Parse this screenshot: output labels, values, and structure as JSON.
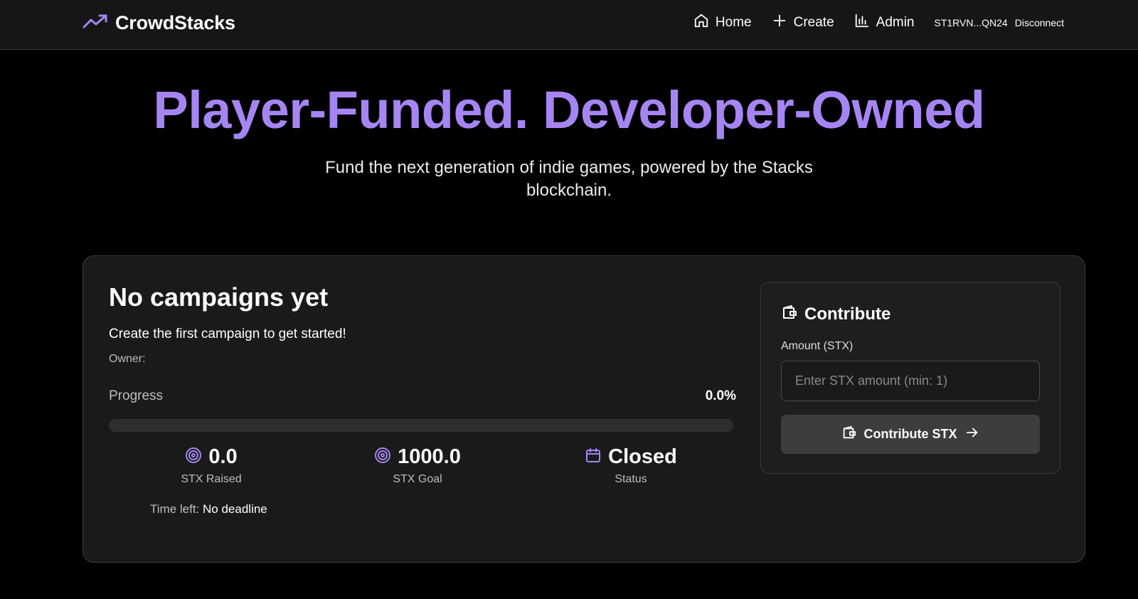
{
  "header": {
    "logo_text": "CrowdStacks",
    "logo_icon": "trending-up-icon",
    "nav": [
      {
        "label": "Home",
        "icon": "home-icon"
      },
      {
        "label": "Create",
        "icon": "plus-icon"
      },
      {
        "label": "Admin",
        "icon": "bar-chart-icon"
      }
    ],
    "wallet_address": "ST1RVN...QN24",
    "disconnect_label": "Disconnect"
  },
  "hero": {
    "title": "Player-Funded. Developer-Owned",
    "subtitle": "Fund the next generation of indie games, powered by the Stacks blockchain."
  },
  "campaign": {
    "title": "No campaigns yet",
    "description": "Create the first campaign to get started!",
    "owner_label": "Owner:",
    "progress_label": "Progress",
    "progress_percent_text": "0.0%",
    "progress_fraction": 0,
    "stats": [
      {
        "value": "0.0",
        "label": "STX Raised",
        "icon": "target-icon"
      },
      {
        "value": "1000.0",
        "label": "STX Goal",
        "icon": "target-icon"
      },
      {
        "value": "Closed",
        "label": "Status",
        "icon": "calendar-icon"
      }
    ],
    "time_left_label": "Time left:",
    "time_left_value": "No deadline"
  },
  "contribute": {
    "title": "Contribute",
    "icon": "wallet-icon",
    "amount_label": "Amount (STX)",
    "amount_placeholder": "Enter STX amount (min: 1)",
    "amount_value": "",
    "button_label": "Contribute STX"
  },
  "colors": {
    "accent": "#a685f3",
    "background": "#000000",
    "card": "#1a1a1a",
    "button": "#3d3d3d"
  }
}
